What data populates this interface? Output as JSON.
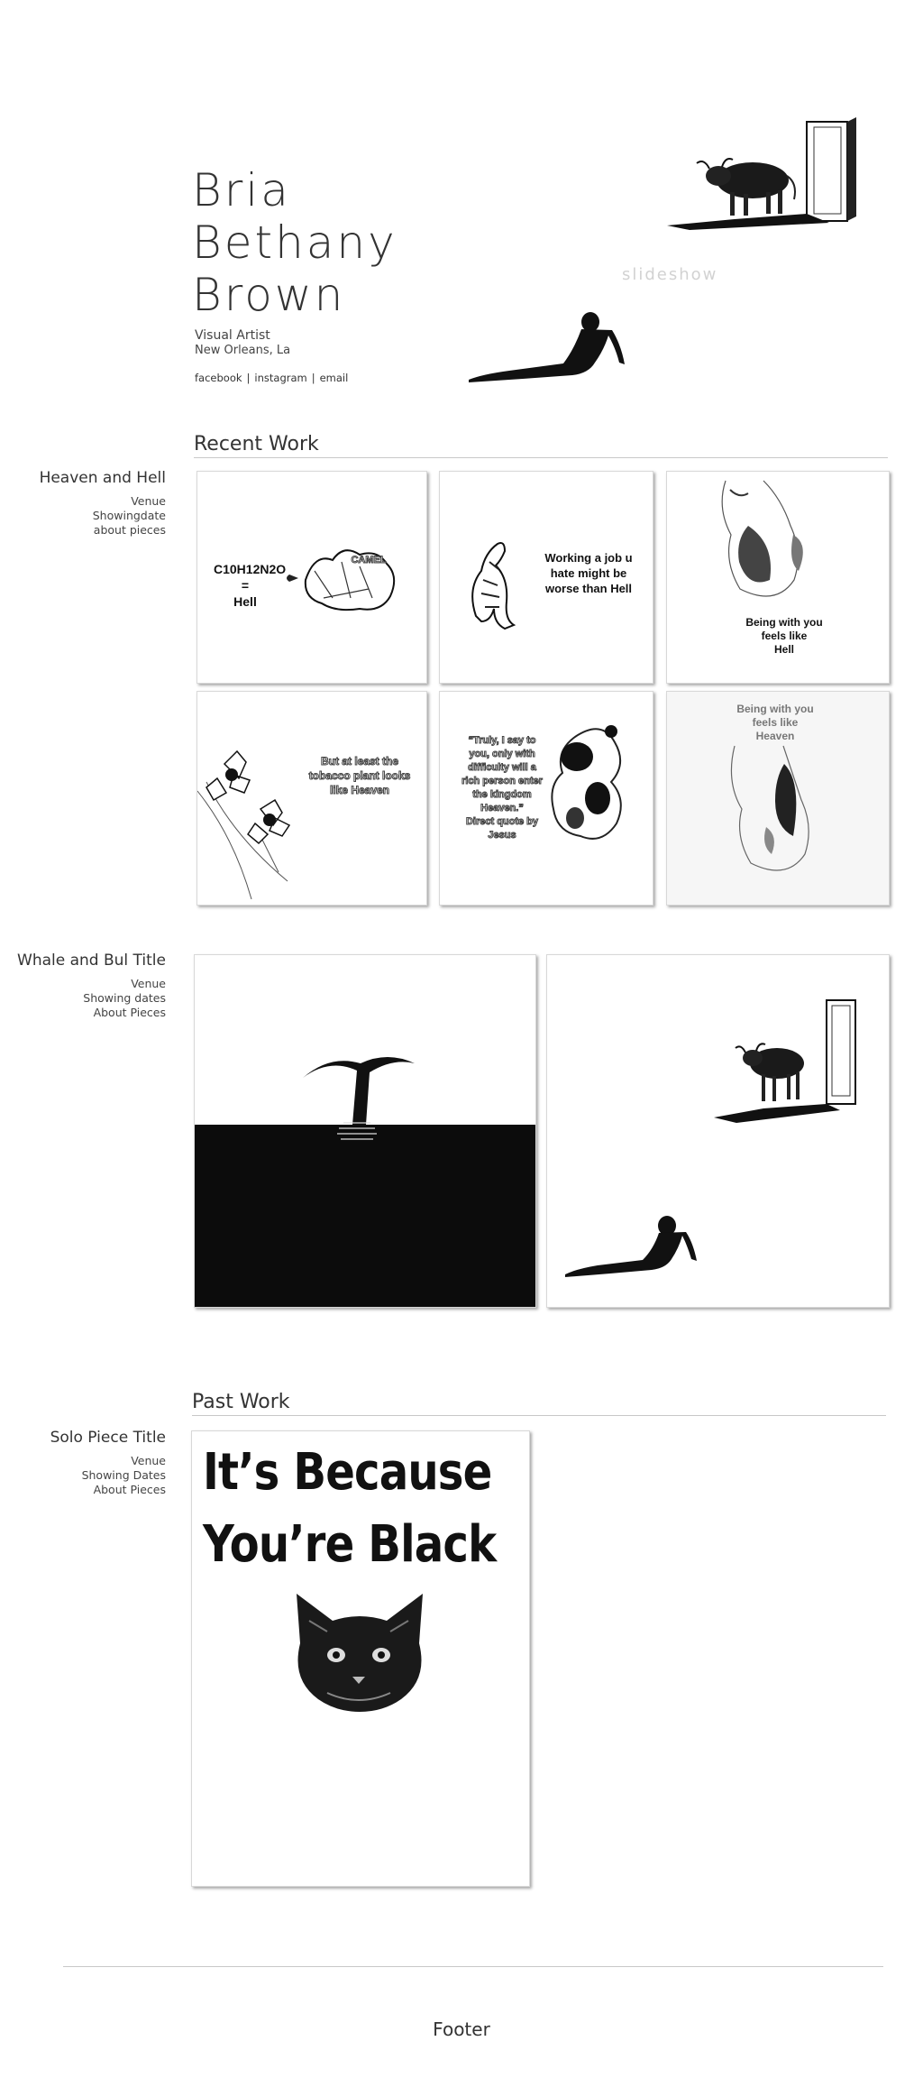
{
  "header": {
    "name_lines": [
      "Bria",
      "Bethany",
      "Brown"
    ],
    "role": "Visual Artist",
    "location": "New Orleans, La",
    "social": [
      "facebook",
      "instagram",
      "email"
    ],
    "social_separator": "|",
    "slideshow_label": "slideshow"
  },
  "recent_work": {
    "heading": "Recent Work",
    "series": [
      {
        "title": "Heaven and Hell",
        "meta": [
          "Venue",
          "Showingdate",
          "about pieces"
        ],
        "pieces": [
          {
            "text_lines": [
              "C10H12N2O",
              "=",
              "Hell"
            ],
            "brand": "CAMEL",
            "icon": "camel-icon"
          },
          {
            "text_lines": [
              "Working a job u",
              "hate might be",
              "worse than Hell"
            ],
            "icon": "tiger-icon"
          },
          {
            "text_lines": [
              "Being with you",
              "feels like",
              "Hell"
            ],
            "icon": "torso-icon"
          },
          {
            "text_lines": [
              "But at least the",
              "tobacco plant looks",
              "like Heaven"
            ],
            "icon": "flower-icon"
          },
          {
            "text_lines": [
              "“Truly, I say to",
              "you, only with",
              "difficulty will a",
              "rich person enter",
              "the kingdom",
              "Heaven.”",
              "Direct quote by",
              "Jesus"
            ],
            "icon": "panda-icon"
          },
          {
            "text_lines": [
              "Being with you",
              "feels like",
              "Heaven"
            ],
            "icon": "torso-icon"
          }
        ]
      },
      {
        "title": "Whale and Bul Title",
        "meta": [
          "Venue",
          "Showing dates",
          "About Pieces"
        ],
        "pieces": [
          {
            "icon": "whale-tail-icon"
          },
          {
            "icon": "bull-door-icon"
          }
        ]
      }
    ]
  },
  "past_work": {
    "heading": "Past Work",
    "series": [
      {
        "title": "Solo Piece Title",
        "meta": [
          "Venue",
          "Showing Dates",
          "About Pieces"
        ],
        "piece": {
          "text_lines": [
            "It’s Because",
            "You’re Black"
          ],
          "icon": "cat-face-icon"
        }
      }
    ]
  },
  "footer": {
    "label": "Footer"
  }
}
